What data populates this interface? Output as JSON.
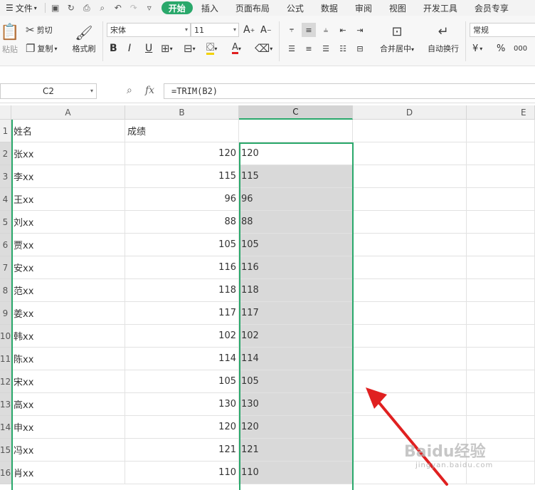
{
  "menubar": {
    "file": "文件",
    "tabs": [
      "开始",
      "插入",
      "页面布局",
      "公式",
      "数据",
      "审阅",
      "视图",
      "开发工具",
      "会员专享"
    ]
  },
  "ribbon": {
    "paste": "粘贴",
    "cut": "剪切",
    "copy": "复制",
    "format_painter": "格式刷",
    "font_name": "宋体",
    "font_size": "11",
    "merge_center": "合并居中",
    "wrap_text": "自动换行",
    "number_format": "常规",
    "bold": "B",
    "italic": "I",
    "underline": "U",
    "currency": "¥",
    "percent": "%"
  },
  "formula_bar": {
    "name_box": "C2",
    "fx": "fx",
    "formula": "=TRIM(B2)"
  },
  "columns": [
    "A",
    "B",
    "C",
    "D",
    "E"
  ],
  "rows": [
    {
      "num": "1",
      "a": "姓名",
      "b": "成绩",
      "c": ""
    },
    {
      "num": "2",
      "a": "张xx",
      "b": "120",
      "c": "120"
    },
    {
      "num": "3",
      "a": "李xx",
      "b": "115",
      "c": "115"
    },
    {
      "num": "4",
      "a": "王xx",
      "b": "96",
      "c": "96"
    },
    {
      "num": "5",
      "a": "刘xx",
      "b": "88",
      "c": "88"
    },
    {
      "num": "6",
      "a": "贾xx",
      "b": "105",
      "c": "105"
    },
    {
      "num": "7",
      "a": "安xx",
      "b": "116",
      "c": "116"
    },
    {
      "num": "8",
      "a": "范xx",
      "b": "118",
      "c": "118"
    },
    {
      "num": "9",
      "a": "姜xx",
      "b": "117",
      "c": "117"
    },
    {
      "num": "10",
      "a": "韩xx",
      "b": "102",
      "c": "102"
    },
    {
      "num": "11",
      "a": "陈xx",
      "b": "114",
      "c": "114"
    },
    {
      "num": "12",
      "a": "宋xx",
      "b": "105",
      "c": "105"
    },
    {
      "num": "13",
      "a": "高xx",
      "b": "130",
      "c": "130"
    },
    {
      "num": "14",
      "a": "申xx",
      "b": "120",
      "c": "120"
    },
    {
      "num": "15",
      "a": "冯xx",
      "b": "121",
      "c": "121"
    },
    {
      "num": "16",
      "a": "肖xx",
      "b": "110",
      "c": "110"
    }
  ],
  "watermark": {
    "main": "Baidu经验",
    "sub": "jingyan.baidu.com"
  },
  "colors": {
    "accent": "#2aa86b",
    "arrow": "#e02020"
  }
}
